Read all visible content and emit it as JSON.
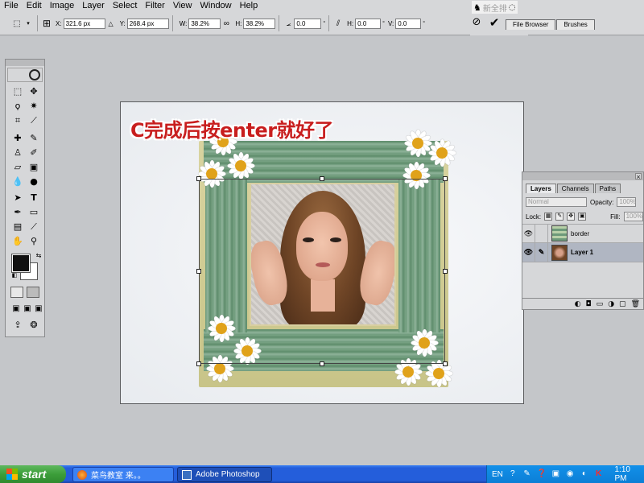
{
  "menu": {
    "items": [
      "File",
      "Edit",
      "Image",
      "Layer",
      "Select",
      "Filter",
      "View",
      "Window",
      "Help"
    ]
  },
  "options": {
    "x_label": "X:",
    "x_value": "321.6 px",
    "y_label": "Y:",
    "y_value": "268.4 px",
    "w_label": "W:",
    "w_value": "38.2%",
    "h_label": "H:",
    "h_value": "38.2%",
    "angle_value": "0.0",
    "hskew_label": "H:",
    "hskew_value": "0.0",
    "vskew_label": "V:",
    "vskew_value": "0.0"
  },
  "topright": {
    "new_doc_label": "新全排",
    "tabs": [
      "File Browser",
      "Brushes"
    ]
  },
  "document": {
    "annotation": "C完成后按enter就好了"
  },
  "layers": {
    "tabs": [
      "Layers",
      "Channels",
      "Paths"
    ],
    "blend_mode": "Normal",
    "opacity_label": "Opacity:",
    "opacity_value": "100%",
    "lock_label": "Lock:",
    "fill_label": "Fill:",
    "fill_value": "100%",
    "rows": [
      {
        "name": "border",
        "selected": false
      },
      {
        "name": "Layer 1",
        "selected": true
      }
    ]
  },
  "taskbar": {
    "start_label": "start",
    "tasks": [
      {
        "label": "菜鸟教室 来。。",
        "active": false
      },
      {
        "label": "Adobe Photoshop",
        "active": true
      }
    ],
    "tray_lang": "EN",
    "clock": "1:10 PM"
  },
  "colors": {
    "annotation": "#c81e1e",
    "frame_green": "#6d9a7a",
    "taskbar": "#245edb",
    "start_green": "#3c9e3a"
  }
}
